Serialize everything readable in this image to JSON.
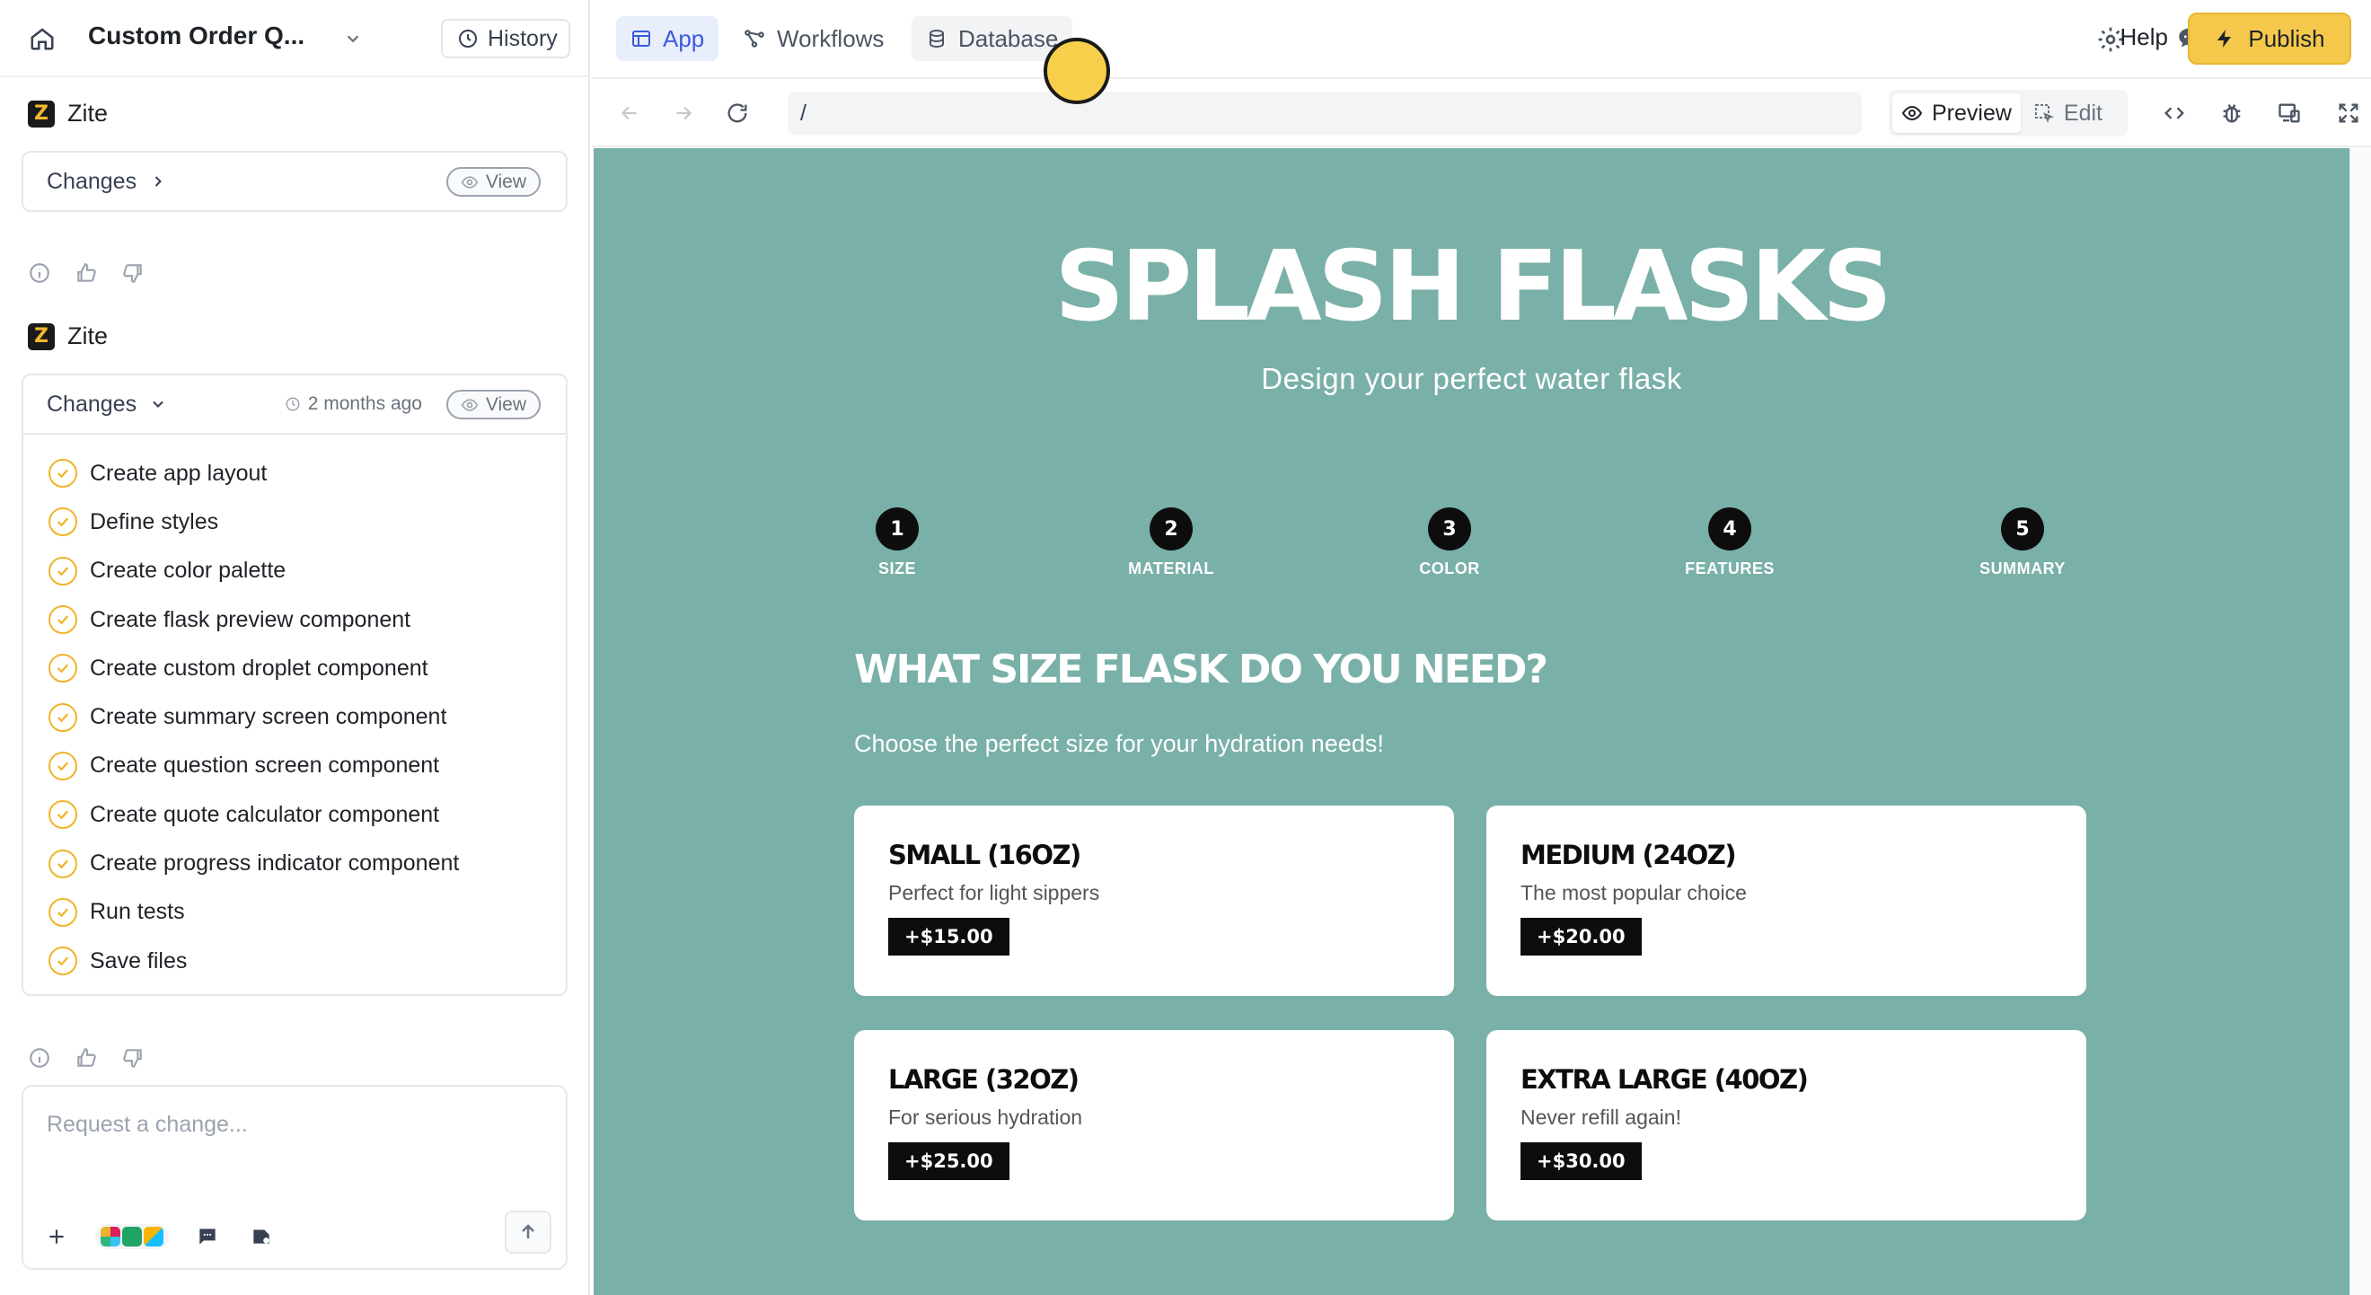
{
  "project": {
    "title": "Custom Order Q...",
    "history_label": "History"
  },
  "thread": [
    {
      "brand": "Zite",
      "changes_label": "Changes",
      "view_label": "View"
    },
    {
      "brand": "Zite",
      "changes_label": "Changes",
      "time": "2 months ago",
      "view_label": "View"
    }
  ],
  "tasks": [
    "Create app layout",
    "Define styles",
    "Create color palette",
    "Create flask preview component",
    "Create custom droplet component",
    "Create summary screen component",
    "Create question screen component",
    "Create quote calculator component",
    "Create progress indicator component",
    "Run tests",
    "Save files"
  ],
  "request": {
    "placeholder": "Request a change..."
  },
  "topbar": {
    "tabs": [
      "App",
      "Workflows",
      "Database"
    ],
    "active_tab": "App",
    "help_label": "Help",
    "publish_label": "Publish"
  },
  "navbar": {
    "url": "/",
    "preview_label": "Preview",
    "edit_label": "Edit"
  },
  "app": {
    "title": "SPLASH FLASKS",
    "subtitle": "Design your perfect water flask",
    "steps": [
      {
        "num": "1",
        "label": "SIZE"
      },
      {
        "num": "2",
        "label": "MATERIAL"
      },
      {
        "num": "3",
        "label": "COLOR"
      },
      {
        "num": "4",
        "label": "FEATURES"
      },
      {
        "num": "5",
        "label": "SUMMARY"
      }
    ],
    "question": "WHAT SIZE FLASK DO YOU NEED?",
    "question_sub": "Choose the perfect size for your hydration needs!",
    "options": [
      {
        "name": "SMALL (16OZ)",
        "desc": "Perfect for light sippers",
        "price": "+$15.00"
      },
      {
        "name": "MEDIUM (24OZ)",
        "desc": "The most popular choice",
        "price": "+$20.00"
      },
      {
        "name": "LARGE (32OZ)",
        "desc": "For serious hydration",
        "price": "+$25.00"
      },
      {
        "name": "EXTRA LARGE (40OZ)",
        "desc": "Never refill again!",
        "price": "+$30.00"
      }
    ]
  },
  "colors": {
    "preview_bg": "#79b0a8",
    "accent": "#f5c84c",
    "active_tab": "#3b5bdb"
  }
}
